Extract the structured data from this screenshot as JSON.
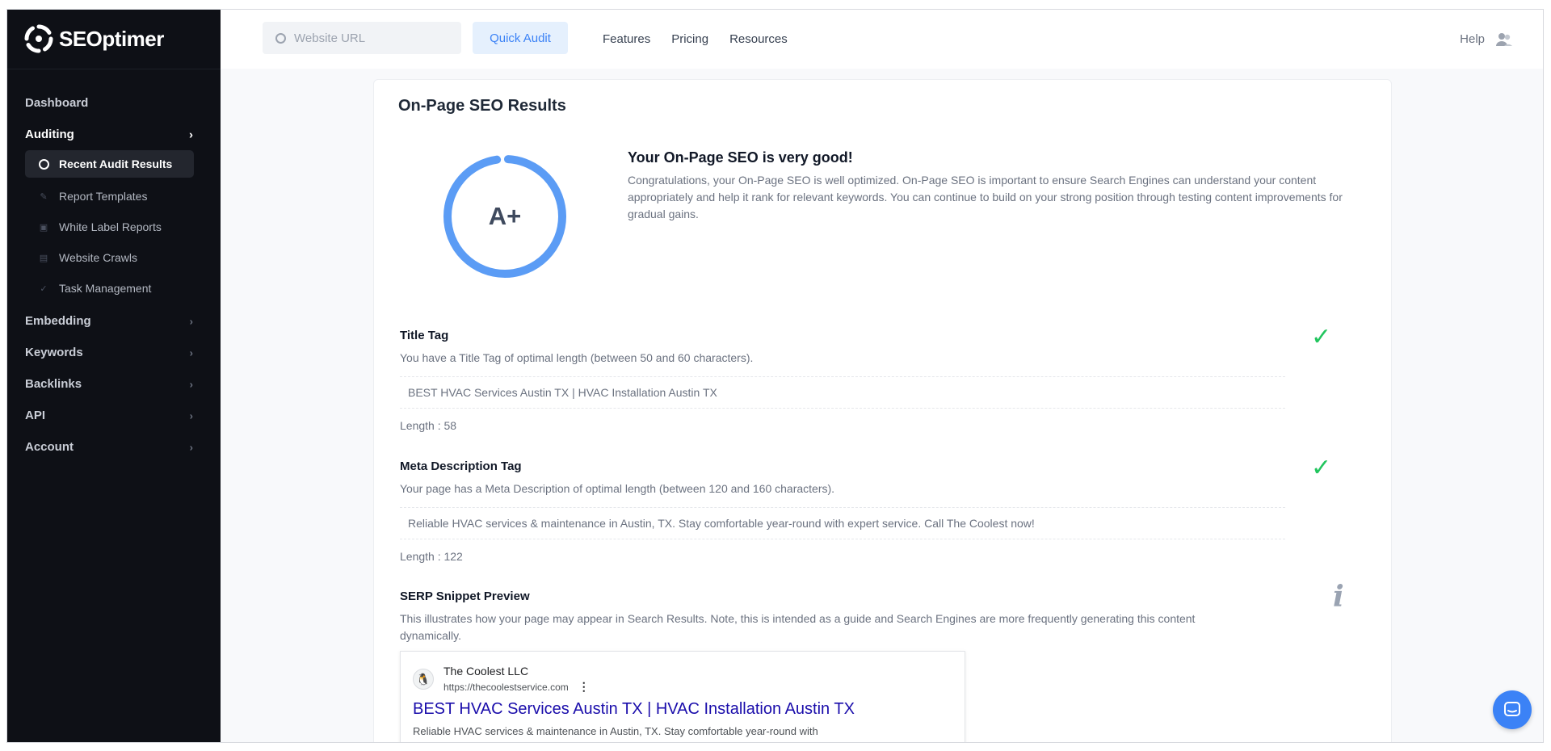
{
  "brand": {
    "name": "SEOptimer"
  },
  "sidebar": {
    "items": [
      {
        "label": "Dashboard",
        "active": false
      },
      {
        "label": "Auditing",
        "active": true
      },
      {
        "label": "Embedding"
      },
      {
        "label": "Keywords"
      },
      {
        "label": "Backlinks"
      },
      {
        "label": "API"
      },
      {
        "label": "Account"
      }
    ],
    "auditing_sub": [
      {
        "label": "Recent Audit Results",
        "icon": "circle-icon",
        "selected": true
      },
      {
        "label": "Report Templates",
        "icon": "pencil-icon"
      },
      {
        "label": "White Label Reports",
        "icon": "document-icon"
      },
      {
        "label": "Website Crawls",
        "icon": "search-doc-icon"
      },
      {
        "label": "Task Management",
        "icon": "check-icon"
      }
    ]
  },
  "topbar": {
    "search_placeholder": "Website URL",
    "quick_audit_label": "Quick Audit",
    "links": [
      "Features",
      "Pricing",
      "Resources"
    ],
    "help_label": "Help"
  },
  "main": {
    "title": "On-Page SEO Results",
    "grade": "A+",
    "summary_heading": "Your On-Page SEO is very good!",
    "summary_text": "Congratulations, your On-Page SEO is well optimized. On-Page SEO is important to ensure Search Engines can understand your content appropriately and help it rank for relevant keywords. You can continue to build on your strong position through testing content improvements for gradual gains.",
    "title_tag": {
      "heading": "Title Tag",
      "description": "You have a Title Tag of optimal length (between 50 and 60 characters).",
      "value": "BEST HVAC Services Austin TX | HVAC Installation Austin TX",
      "length": "Length : 58"
    },
    "meta_desc": {
      "heading": "Meta Description Tag",
      "description": "Your page has a Meta Description of optimal length (between 120 and 160 characters).",
      "value": "Reliable HVAC services & maintenance in Austin, TX. Stay comfortable year-round with expert service. Call The Coolest now!",
      "length": "Length : 122"
    },
    "serp": {
      "heading": "SERP Snippet Preview",
      "description": "This illustrates how your page may appear in Search Results. Note, this is intended as a guide and Search Engines are more frequently generating this content dynamically.",
      "site_name": "The Coolest LLC",
      "url": "https://thecoolestservice.com",
      "title": "BEST HVAC Services Austin TX | HVAC Installation Austin TX",
      "snippet": "Reliable HVAC services & maintenance in Austin, TX. Stay comfortable year-round with"
    }
  },
  "colors": {
    "accent": "#3b82f6",
    "grade_ring": "#5b9cf5",
    "success": "#22c55e",
    "sidebar_bg": "#0e1016"
  }
}
